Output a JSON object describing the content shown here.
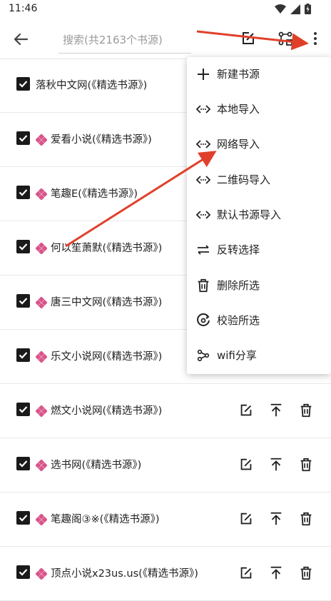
{
  "status_bar": {
    "time": "11:46"
  },
  "toolbar": {
    "search_placeholder": "搜索(共2163个书源)"
  },
  "sources": [
    {
      "name": "落秋中文网",
      "group": "(《精选书源》)",
      "diamond": false,
      "actions": false
    },
    {
      "name": "爱看小说",
      "group": "(《精选书源》)",
      "diamond": true,
      "actions": false
    },
    {
      "name": "笔趣E",
      "group": "(《精选书源》)",
      "diamond": true,
      "actions": false
    },
    {
      "name": "何以笙萧默",
      "group": "(《精选书源》)",
      "diamond": true,
      "actions": false
    },
    {
      "name": "唐三中文网",
      "group": "(《精选书源》)",
      "diamond": true,
      "actions": false
    },
    {
      "name": "乐文小说网",
      "group": "(《精选书源》)",
      "diamond": true,
      "actions": false
    },
    {
      "name": "燃文小说网",
      "group": "(《精选书源》)",
      "diamond": true,
      "actions": true
    },
    {
      "name": "选书网",
      "group": "(《精选书源》)",
      "diamond": true,
      "actions": true
    },
    {
      "name": "笔趣阁③※",
      "group": "(《精选书源》)",
      "diamond": true,
      "actions": true
    },
    {
      "name": "顶点小说x23us.us",
      "group": "(《精选书源》)",
      "diamond": true,
      "actions": true
    }
  ],
  "menu": {
    "items": [
      {
        "label": "新建书源",
        "icon": "plus-icon"
      },
      {
        "label": "本地导入",
        "icon": "code-arrows-icon"
      },
      {
        "label": "网络导入",
        "icon": "code-arrows-icon"
      },
      {
        "label": "二维码导入",
        "icon": "code-arrows-icon"
      },
      {
        "label": "默认书源导入",
        "icon": "code-arrows-icon"
      },
      {
        "label": "反转选择",
        "icon": "swap-icon"
      },
      {
        "label": "删除所选",
        "icon": "trash-icon"
      },
      {
        "label": "校验所选",
        "icon": "verify-icon"
      },
      {
        "label": "wifi分享",
        "icon": "share-icon"
      }
    ]
  },
  "colors": {
    "accent_red": "#e0402a",
    "diamond_pink": "#d9558a",
    "checkbox": "#1a1a1a"
  }
}
